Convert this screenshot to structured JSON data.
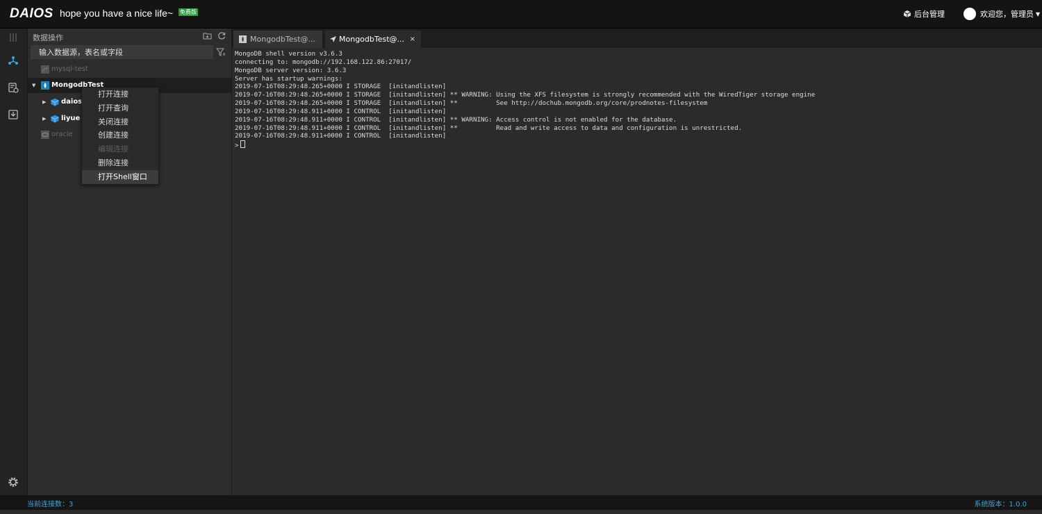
{
  "app": {
    "logo": "DAIOS",
    "slogan": "hope you have a nice life~",
    "badge": "免费版"
  },
  "header": {
    "admin_label": "后台管理",
    "user_label": "欢迎您，管理员"
  },
  "panel": {
    "title": "数据操作",
    "search_placeholder": "输入数据源，表名或字段",
    "tree": {
      "mysql": "mysql-test",
      "mongo": "MongodbTest",
      "db1": "daios",
      "db2": "liyue",
      "oracle": "oracle"
    }
  },
  "context_menu": {
    "items": [
      "打开连接",
      "打开查询",
      "关闭连接",
      "创建连接",
      "编辑连接",
      "删除连接",
      "打开Shell窗口"
    ]
  },
  "tabs": {
    "tab1": "MongodbTest@...",
    "tab2": "MongodbTest@...",
    "close": "×"
  },
  "shell": {
    "lines": [
      "MongoDB shell version v3.6.3",
      "connecting to: mongodb://192.168.122.86:27017/",
      "MongoDB server version: 3.6.3",
      "Server has startup warnings:",
      "2019-07-16T08:29:48.265+0000 I STORAGE  [initandlisten]",
      "2019-07-16T08:29:48.265+0000 I STORAGE  [initandlisten] ** WARNING: Using the XFS filesystem is strongly recommended with the WiredTiger storage engine",
      "2019-07-16T08:29:48.265+0000 I STORAGE  [initandlisten] **          See http://dochub.mongodb.org/core/prodnotes-filesystem",
      "2019-07-16T08:29:48.911+0000 I CONTROL  [initandlisten]",
      "2019-07-16T08:29:48.911+0000 I CONTROL  [initandlisten] ** WARNING: Access control is not enabled for the database.",
      "2019-07-16T08:29:48.911+0000 I CONTROL  [initandlisten] **          Read and write access to data and configuration is unrestricted.",
      "2019-07-16T08:29:48.911+0000 I CONTROL  [initandlisten]"
    ],
    "prompt": ">"
  },
  "status": {
    "connections": "当前连接数：3",
    "version": "系统版本：1.0.0"
  },
  "colors": {
    "accent": "#3aa6e0",
    "badge": "#2e9a3b"
  }
}
